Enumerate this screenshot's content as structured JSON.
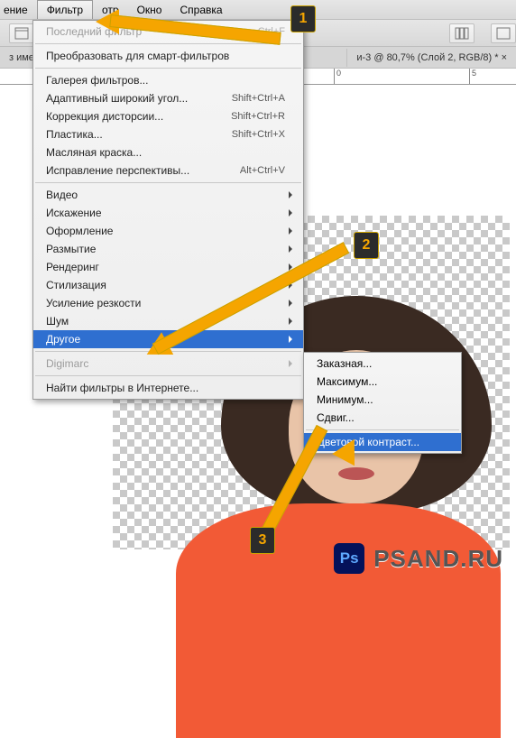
{
  "menubar": {
    "items": [
      "ение",
      "Фильтр",
      "отр",
      "Окно",
      "Справка"
    ],
    "open_index": 1
  },
  "tabstrip": {
    "left": "з име",
    "right": "и-3 @ 80,7% (Слой 2, RGB/8) * ×"
  },
  "ruler": {
    "marks": [
      "0",
      "5"
    ]
  },
  "menu": {
    "sections": [
      [
        {
          "label": "Последний фильтр",
          "shortcut": "Ctrl+F",
          "disabled": true
        }
      ],
      [
        {
          "label": "Преобразовать для смарт-фильтров"
        }
      ],
      [
        {
          "label": "Галерея фильтров..."
        },
        {
          "label": "Адаптивный широкий угол...",
          "shortcut": "Shift+Ctrl+A"
        },
        {
          "label": "Коррекция дисторсии...",
          "shortcut": "Shift+Ctrl+R"
        },
        {
          "label": "Пластика...",
          "shortcut": "Shift+Ctrl+X"
        },
        {
          "label": "Масляная краска..."
        },
        {
          "label": "Исправление перспективы...",
          "shortcut": "Alt+Ctrl+V"
        }
      ],
      [
        {
          "label": "Видео",
          "submenu": true
        },
        {
          "label": "Искажение",
          "submenu": true
        },
        {
          "label": "Оформление",
          "submenu": true
        },
        {
          "label": "Размытие",
          "submenu": true
        },
        {
          "label": "Рендеринг",
          "submenu": true
        },
        {
          "label": "Стилизация",
          "submenu": true
        },
        {
          "label": "Усиление резкости",
          "submenu": true
        },
        {
          "label": "Шум",
          "submenu": true
        },
        {
          "label": "Другое",
          "submenu": true,
          "highlight": true
        }
      ],
      [
        {
          "label": "Digimarc",
          "submenu": true,
          "disabled": true
        }
      ],
      [
        {
          "label": "Найти фильтры в Интернете..."
        }
      ]
    ]
  },
  "submenu": {
    "items": [
      {
        "label": "Заказная..."
      },
      {
        "label": "Максимум..."
      },
      {
        "label": "Минимум..."
      },
      {
        "label": "Сдвиг..."
      },
      {
        "label": "Цветовой контраст...",
        "highlight": true
      }
    ]
  },
  "badges": {
    "b1": "1",
    "b2": "2",
    "b3": "3"
  },
  "footer": {
    "logo": "Ps",
    "site": "PSAND.RU"
  }
}
